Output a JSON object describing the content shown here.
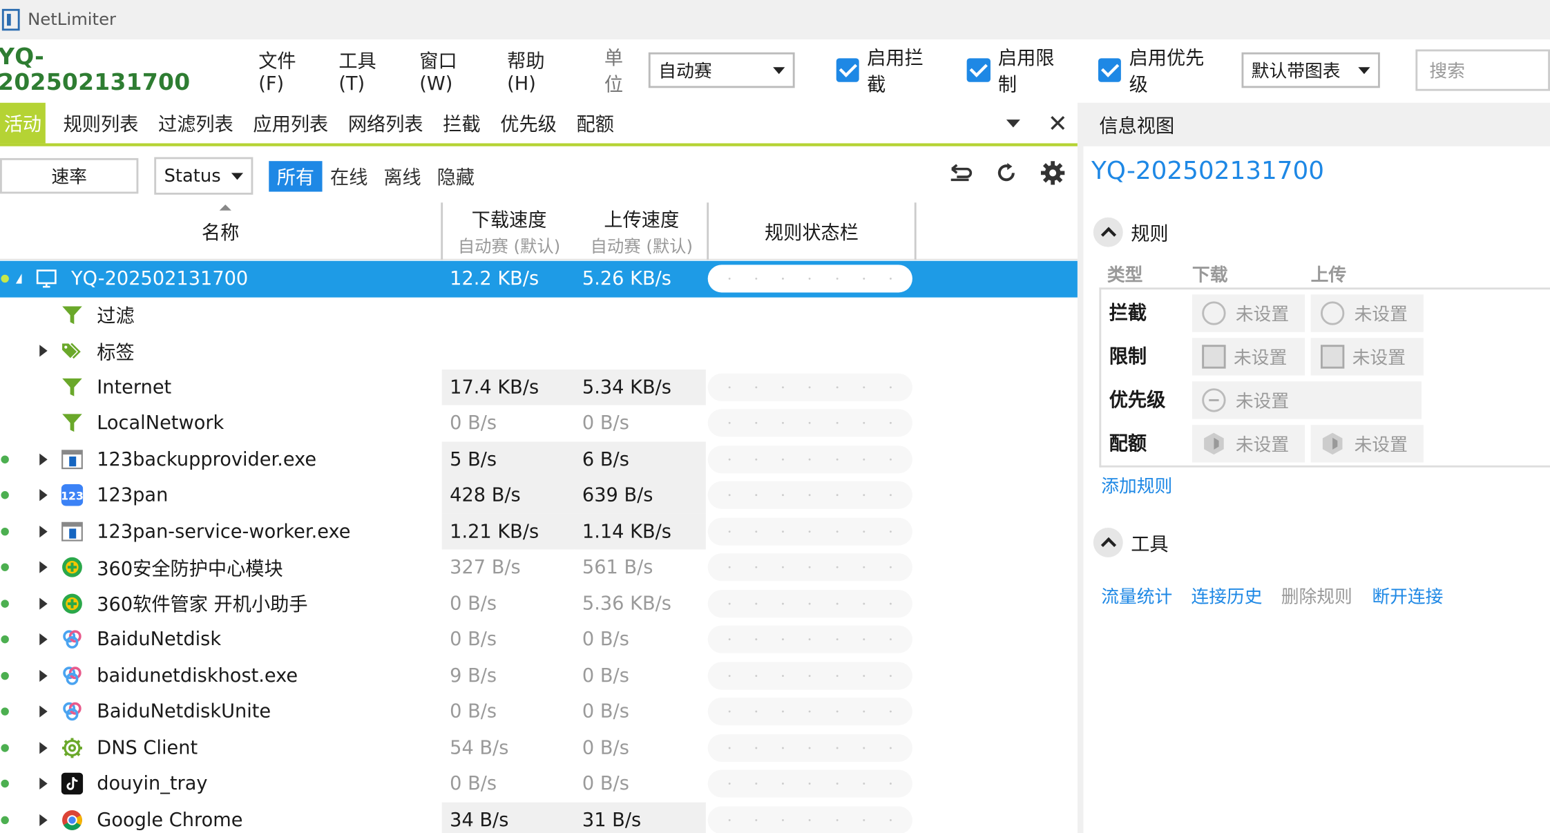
{
  "app": {
    "title": "NetLimiter"
  },
  "toolbar": {
    "machine": "YQ-202502131700",
    "menu": [
      "文件(F)",
      "工具(T)",
      "窗口(W)",
      "帮助(H)"
    ],
    "unit_label": "单位",
    "unit_value": "自动赛",
    "check_block": "启用拦截",
    "check_limit": "启用限制",
    "check_priority": "启用优先级",
    "chart_select": "默认带图表",
    "search_placeholder": "搜索"
  },
  "tabs": [
    "活动",
    "规则列表",
    "过滤列表",
    "应用列表",
    "网络列表",
    "拦截",
    "优先级",
    "配额"
  ],
  "filterbar": {
    "speed_button": "速率",
    "status_select": "Status",
    "segments": [
      "所有",
      "在线",
      "离线",
      "隐藏"
    ]
  },
  "columns": {
    "name": "名称",
    "download": "下载速度",
    "download_sub": "自动赛 (默认)",
    "upload": "上传速度",
    "upload_sub": "自动赛 (默认)",
    "rule_status": "规则状态栏"
  },
  "rows": [
    {
      "name": "YQ-202502131700",
      "dl": "12.2 KB/s",
      "ul": "5.26 KB/s",
      "icon": "monitor-icon"
    },
    {
      "name": "过滤",
      "dl": "",
      "ul": "",
      "icon": "filter-icon"
    },
    {
      "name": "标签",
      "dl": "",
      "ul": "",
      "icon": "tags-icon"
    },
    {
      "name": "Internet",
      "dl": "17.4 KB/s",
      "ul": "5.34 KB/s",
      "icon": "filter-icon"
    },
    {
      "name": "LocalNetwork",
      "dl": "0 B/s",
      "ul": "0 B/s",
      "icon": "filter-icon"
    },
    {
      "name": "123backupprovider.exe",
      "dl": "5 B/s",
      "ul": "6 B/s",
      "icon": "app-window-icon"
    },
    {
      "name": "123pan",
      "dl": "428 B/s",
      "ul": "639 B/s",
      "icon": "123pan-icon"
    },
    {
      "name": "123pan-service-worker.exe",
      "dl": "1.21 KB/s",
      "ul": "1.14 KB/s",
      "icon": "app-window-icon"
    },
    {
      "name": "360安全防护中心模块",
      "dl": "327 B/s",
      "ul": "561 B/s",
      "icon": "360-icon"
    },
    {
      "name": "360软件管家 开机小助手",
      "dl": "0 B/s",
      "ul": "5.36 KB/s",
      "icon": "360-icon"
    },
    {
      "name": "BaiduNetdisk",
      "dl": "0 B/s",
      "ul": "0 B/s",
      "icon": "baidu-netdisk-icon"
    },
    {
      "name": "baidunetdiskhost.exe",
      "dl": "9 B/s",
      "ul": "0 B/s",
      "icon": "baidu-netdisk-icon"
    },
    {
      "name": "BaiduNetdiskUnite",
      "dl": "0 B/s",
      "ul": "0 B/s",
      "icon": "baidu-netdisk-icon"
    },
    {
      "name": "DNS Client",
      "dl": "54 B/s",
      "ul": "0 B/s",
      "icon": "gear-icon"
    },
    {
      "name": "douyin_tray",
      "dl": "0 B/s",
      "ul": "0 B/s",
      "icon": "douyin-icon"
    },
    {
      "name": "Google Chrome",
      "dl": "34 B/s",
      "ul": "31 B/s",
      "icon": "chrome-icon"
    }
  ],
  "info": {
    "header": "信息视图",
    "machine": "YQ-202502131700",
    "rules_title": "规则",
    "col_type": "类型",
    "col_download": "下载",
    "col_upload": "上传",
    "rule_block": "拦截",
    "rule_limit": "限制",
    "rule_priority": "优先级",
    "rule_quota": "配额",
    "not_set": "未设置",
    "add_rule": "添加规则",
    "tools_title": "工具",
    "tool_stats": "流量统计",
    "tool_history": "连接历史",
    "tool_delete": "删除规则",
    "tool_disconnect": "断开连接"
  },
  "colors": {
    "accent": "#1e88e5",
    "tab_green": "#b5d334",
    "machine_green": "#2e7d32",
    "selection": "#1e9be6"
  }
}
